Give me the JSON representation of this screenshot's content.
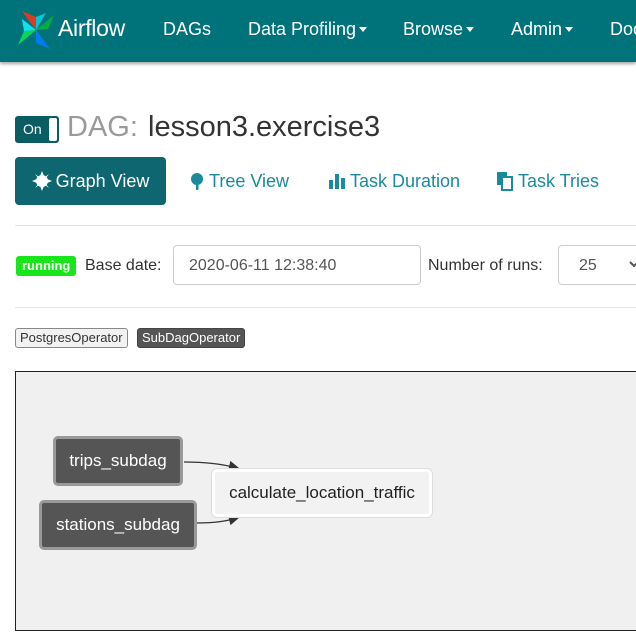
{
  "navbar": {
    "brand": "Airflow",
    "items": [
      {
        "label": "DAGs",
        "dropdown": false
      },
      {
        "label": "Data Profiling",
        "dropdown": true
      },
      {
        "label": "Browse",
        "dropdown": true
      },
      {
        "label": "Admin",
        "dropdown": true
      },
      {
        "label": "Doc",
        "dropdown": false
      }
    ]
  },
  "dag": {
    "toggle_label": "On",
    "prefix": "DAG:",
    "id": "lesson3.exercise3"
  },
  "tabs": [
    {
      "label": "Graph View",
      "icon": "asterisk-icon",
      "active": true
    },
    {
      "label": "Tree View",
      "icon": "tree-icon",
      "active": false
    },
    {
      "label": "Task Duration",
      "icon": "bar-chart-icon",
      "active": false
    },
    {
      "label": "Task Tries",
      "icon": "duplicate-icon",
      "active": false
    }
  ],
  "controls": {
    "state_badge": "running",
    "base_date_label": "Base date:",
    "base_date_value": "2020-06-11 12:38:40",
    "num_runs_label": "Number of runs:",
    "num_runs_value": "25"
  },
  "legend": {
    "operators": [
      "PostgresOperator",
      "SubDagOperator"
    ]
  },
  "graph": {
    "nodes": [
      {
        "id": "trips_subdag",
        "operator": "SubDagOperator"
      },
      {
        "id": "stations_subdag",
        "operator": "SubDagOperator"
      },
      {
        "id": "calculate_location_traffic",
        "operator": "PostgresOperator"
      }
    ],
    "edges": [
      [
        "trips_subdag",
        "calculate_location_traffic"
      ],
      [
        "stations_subdag",
        "calculate_location_traffic"
      ]
    ]
  },
  "colors": {
    "navbar": "#00737a",
    "active_tab": "#0d6670",
    "link": "#1a8a9c",
    "running": "#19e61a",
    "subdag_node": "#555555"
  }
}
